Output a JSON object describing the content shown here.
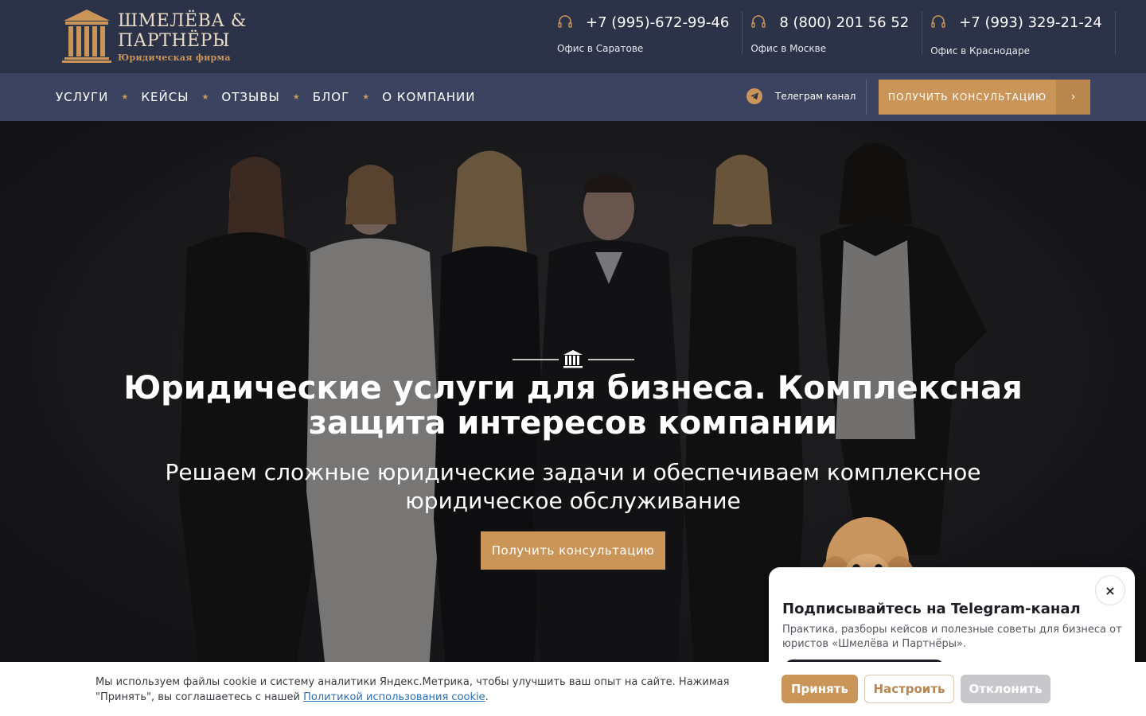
{
  "header": {
    "logo": {
      "line1": "ШМЕЛЁВА &",
      "line2": "ПАРТНЁРЫ",
      "subtitle": "Юридическая фирма"
    },
    "phones": [
      {
        "number": "+7 (995)-672-99-46",
        "office": "Офис в Саратове",
        "icon": "headset-icon"
      },
      {
        "number": "8 (800) 201 56 52",
        "office": "Офис в Москве",
        "icon": "headset-icon"
      },
      {
        "number": "+7 (993) 329-21-24",
        "office": "Офис в Краснодаре",
        "icon": "headset-icon"
      }
    ]
  },
  "nav": {
    "items": [
      "УСЛУГИ",
      "КЕЙСЫ",
      "ОТЗЫВЫ",
      "БЛОГ",
      "О КОМПАНИИ"
    ],
    "separator": "★",
    "telegram_label": "Телеграм канал",
    "cta_label": "ПОЛУЧИТЬ КОНСУЛЬТАЦИЮ",
    "cta_arrow": "›"
  },
  "hero": {
    "title": "Юридические услуги для бизнеса. Комплексная защита интересов компании",
    "subtitle": "Решаем сложные юридические задачи и обеспечиваем комплексное юридическое обслуживание",
    "button_label": "Получить консультацию"
  },
  "telegram_popup": {
    "close_label": "×",
    "title": "Подписывайтесь на Telegram-канал",
    "text": "Практика, разборы кейсов и полезные советы для бизнеса от юристов «Шмелёва и Партнёры»."
  },
  "cookie": {
    "text": "Мы используем файлы cookie и систему аналитики Яндекс.Метрика, чтобы улучшить ваш опыт на сайте. Нажимая \"Принять\", вы соглашаетесь с нашей ",
    "link_text": "Политикой использования cookie",
    "text_end": ".",
    "accept_label": "Принять",
    "configure_label": "Настроить",
    "decline_label": "Отклонить"
  },
  "colors": {
    "accent": "#c99559",
    "topbar": "#2c3248",
    "navbar": "#3c4360"
  }
}
